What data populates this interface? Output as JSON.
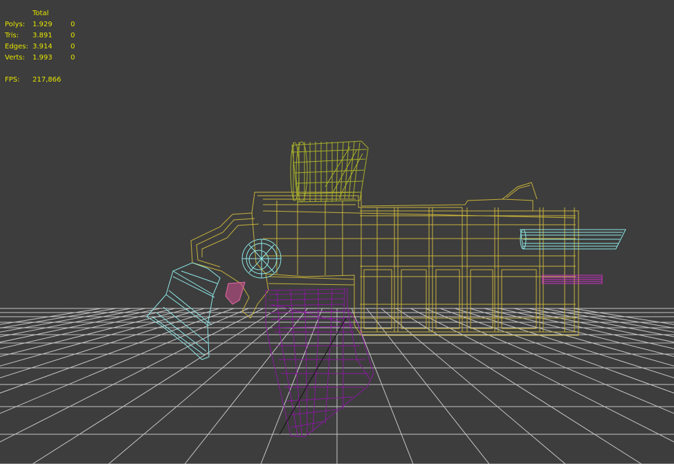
{
  "viewport": {
    "background": "#3d3d3d",
    "text_color": "#e6e600",
    "grid_color": "#c8c8c8",
    "wire_colors": {
      "body": "#c8b23a",
      "turret": "#a8b02a",
      "cyan_parts": "#8ee8e8",
      "purple_mesh": "#8a1aa0",
      "magenta_rod": "#d030c8",
      "pink_part": "#e86aa8"
    }
  },
  "stats": {
    "header": "Total",
    "rows": [
      {
        "label": "Polys:",
        "total": "1.929",
        "selected": "0"
      },
      {
        "label": "Tris:",
        "total": "3.891",
        "selected": "0"
      },
      {
        "label": "Edges:",
        "total": "3.914",
        "selected": "0"
      },
      {
        "label": "Verts:",
        "total": "1.993",
        "selected": "0"
      }
    ],
    "fps_label": "FPS:",
    "fps_value": "217,866"
  }
}
